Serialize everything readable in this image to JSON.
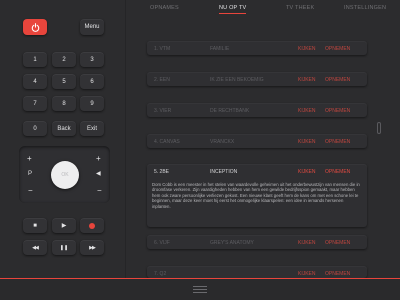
{
  "remote": {
    "menu_label": "Menu",
    "digits": [
      "1",
      "2",
      "3",
      "4",
      "5",
      "6",
      "7",
      "8",
      "9",
      "0"
    ],
    "back_label": "Back",
    "exit_label": "Exit",
    "plus_glyph": "+",
    "minus_glyph": "−",
    "p_label": "P",
    "ok_label": "OK",
    "volume_glyph": "◀",
    "stop_glyph": "■",
    "play_glyph": "▶",
    "rewind_glyph": "◀◀",
    "pause_glyph": "❚❚",
    "forward_glyph": "▶▶"
  },
  "tabs": [
    "OPNAMES",
    "NU OP TV",
    "TV THEEK",
    "INSTELLINGEN"
  ],
  "active_tab": "NU OP TV",
  "channels": [
    {
      "nr": "1. VTM",
      "show": "FAMILIE",
      "watch": "KIJKEN",
      "record": "OPNEMEN"
    },
    {
      "nr": "2. EEN",
      "show": "IK ZIE EEN BEKOEMIG",
      "watch": "KIJKEN",
      "record": "OPNEMEN"
    },
    {
      "nr": "3. VIER",
      "show": "DE RECHTBANK",
      "watch": "KIJKEN",
      "record": "OPNEMEN"
    },
    {
      "nr": "4. CANVAS",
      "show": "VRANCKX",
      "watch": "KIJKEN",
      "record": "OPNEMEN"
    },
    {
      "nr": "5. 2BE",
      "show": "INCEPTION",
      "watch": "KIJKEN",
      "record": "OPNEMEN",
      "description": "Dom Cobb is een meester in het stelen van waardevolle geheimen uit het onderbewustzijn van mensen die in droomfase verkeren. Zijn vaardigheden hebben van hem een gewilde bedrijfsspion gemaakt, maar hebben hem ook zware persoonlijke verliezen gekost. Een nieuwe klant geeft hem de kans om met een schone lei te beginnen, maar deze keer moet hij eerst het onmogelijke klaarspelen: een idee in iemands hersenen inplanten."
    },
    {
      "nr": "6. VIJF",
      "show": "GREY'S ANATOMY",
      "watch": "KIJKEN",
      "record": "OPNEMEN"
    },
    {
      "nr": "7. Q2",
      "show": "",
      "watch": "KIJKEN",
      "record": "OPNEMEN"
    }
  ],
  "colors": {
    "accent": "#e8453c",
    "background": "#2c2c2e",
    "surface": "#323235"
  }
}
